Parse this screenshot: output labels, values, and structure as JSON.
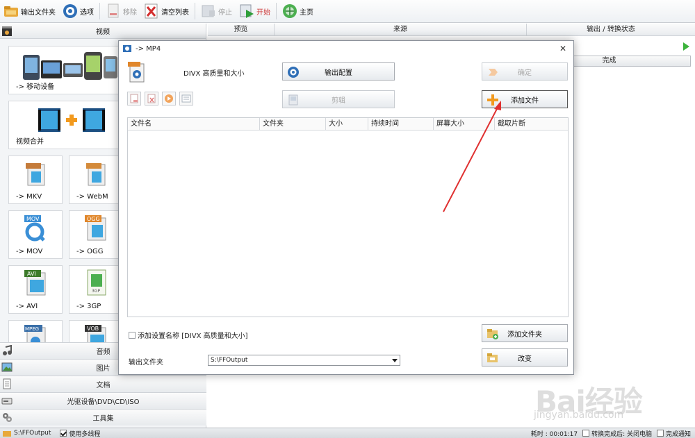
{
  "toolbar": {
    "output_folder": "输出文件夹",
    "options": "选项",
    "remove": "移除",
    "clear_list": "清空列表",
    "stop": "停止",
    "start": "开始",
    "home": "主页"
  },
  "left": {
    "video_header": "视频",
    "tiles": {
      "mobile": "-> 移动设备",
      "merge": "视频合并",
      "mkv": "-> MKV",
      "webm": "-> WebM",
      "mov": "-> MOV",
      "ogg": "-> OGG",
      "avi": "-> AVI",
      "3gp": "-> 3GP"
    },
    "tile_badges": {
      "mov": "MOV",
      "ogg": "OGG",
      "avi": "AVI",
      "mpeg": "MPEG",
      "vob": "VOB",
      "3gp": "3GP"
    },
    "bottom": {
      "audio": "音频",
      "image": "图片",
      "document": "文档",
      "rom": "光驱设备\\DVD\\CD\\ISO",
      "tools": "工具集"
    }
  },
  "right": {
    "columns": {
      "preview": "预览",
      "source": "来源",
      "output_status": "输出 / 转换状态"
    },
    "done": "完成"
  },
  "dialog": {
    "title": "-> MP4",
    "profile_text": "DIVX 高质量和大小",
    "output_config": "输出配置",
    "ok": "确定",
    "edit": "剪辑",
    "add_file": "添加文件",
    "list_columns": {
      "filename": "文件名",
      "folder": "文件夹",
      "size": "大小",
      "duration": "持续时间",
      "screen_size": "屏幕大小",
      "clip": "截取片断"
    },
    "add_setting_name": "添加设置名称 [DIVX 高质量和大小]",
    "add_folder": "添加文件夹",
    "output_folder_label": "输出文件夹",
    "output_folder_value": "S:\\FFOutput",
    "change": "改变"
  },
  "status": {
    "path": "S:\\FFOutput",
    "multithread": "使用多线程",
    "elapsed": "耗时 : 00:01:17",
    "after_convert": "转换完成后: 关闭电脑",
    "notify": "完成通知"
  },
  "watermark": {
    "brand": "Bai经验",
    "url": "jingyan.baidu.com"
  },
  "colors": {
    "annotation_arrow": "#e03131",
    "accent_green": "#3cb33c",
    "start_red": "#cc3333"
  }
}
